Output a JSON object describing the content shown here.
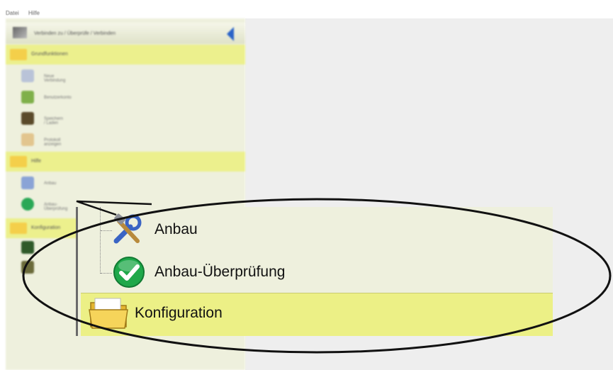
{
  "menubar": {
    "items": [
      "Datei",
      "Hilfe"
    ]
  },
  "sidebar": {
    "title": "Verbinden zu / Überprüfe / Verbinden",
    "groups": [
      {
        "label": "Grundfunktionen",
        "items": [
          {
            "label": "Neue Verbindung",
            "icon": "network-icon"
          },
          {
            "label": "Benutzerkonto",
            "icon": "user-icon"
          },
          {
            "label": "Speichern / Laden",
            "icon": "disk-icon"
          },
          {
            "label": "Protokoll anzeigen",
            "icon": "document-icon"
          }
        ]
      },
      {
        "label": "Hilfe",
        "items": [
          {
            "label": "Anbau",
            "icon": "wrench-icon"
          },
          {
            "label": "Anbau-Überprüfung",
            "icon": "check-icon"
          }
        ]
      },
      {
        "label": "Konfiguration"
      }
    ]
  },
  "zoom": {
    "items": [
      {
        "label": "Anbau",
        "icon": "wrench-icon"
      },
      {
        "label": "Anbau-Überprüfung",
        "icon": "green-check-icon"
      }
    ],
    "group": {
      "label": "Konfiguration",
      "icon": "folder-icon"
    }
  },
  "colors": {
    "group_highlight": "#ecf086",
    "sidebar_bg": "#eef0dd",
    "accent_blue": "#2a63c8",
    "check_green": "#1fa84a"
  }
}
